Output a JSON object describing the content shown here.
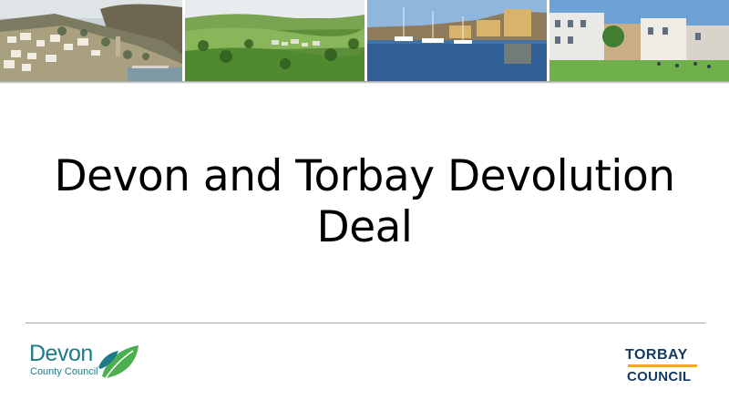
{
  "slide": {
    "title": "Devon and Torbay Devolution Deal"
  },
  "banner": {
    "photos": [
      {
        "name": "coastal-town"
      },
      {
        "name": "green-countryside"
      },
      {
        "name": "harbour-marina"
      },
      {
        "name": "town-green"
      }
    ]
  },
  "logos": {
    "devon": {
      "name": "Devon",
      "subtitle": "County Council",
      "color": "#1d7a87",
      "leaf_color": "#4caf50"
    },
    "torbay": {
      "line1": "TORBAY",
      "line2": "COUNCIL",
      "color": "#143a63",
      "accent": "#f2a81d"
    }
  }
}
